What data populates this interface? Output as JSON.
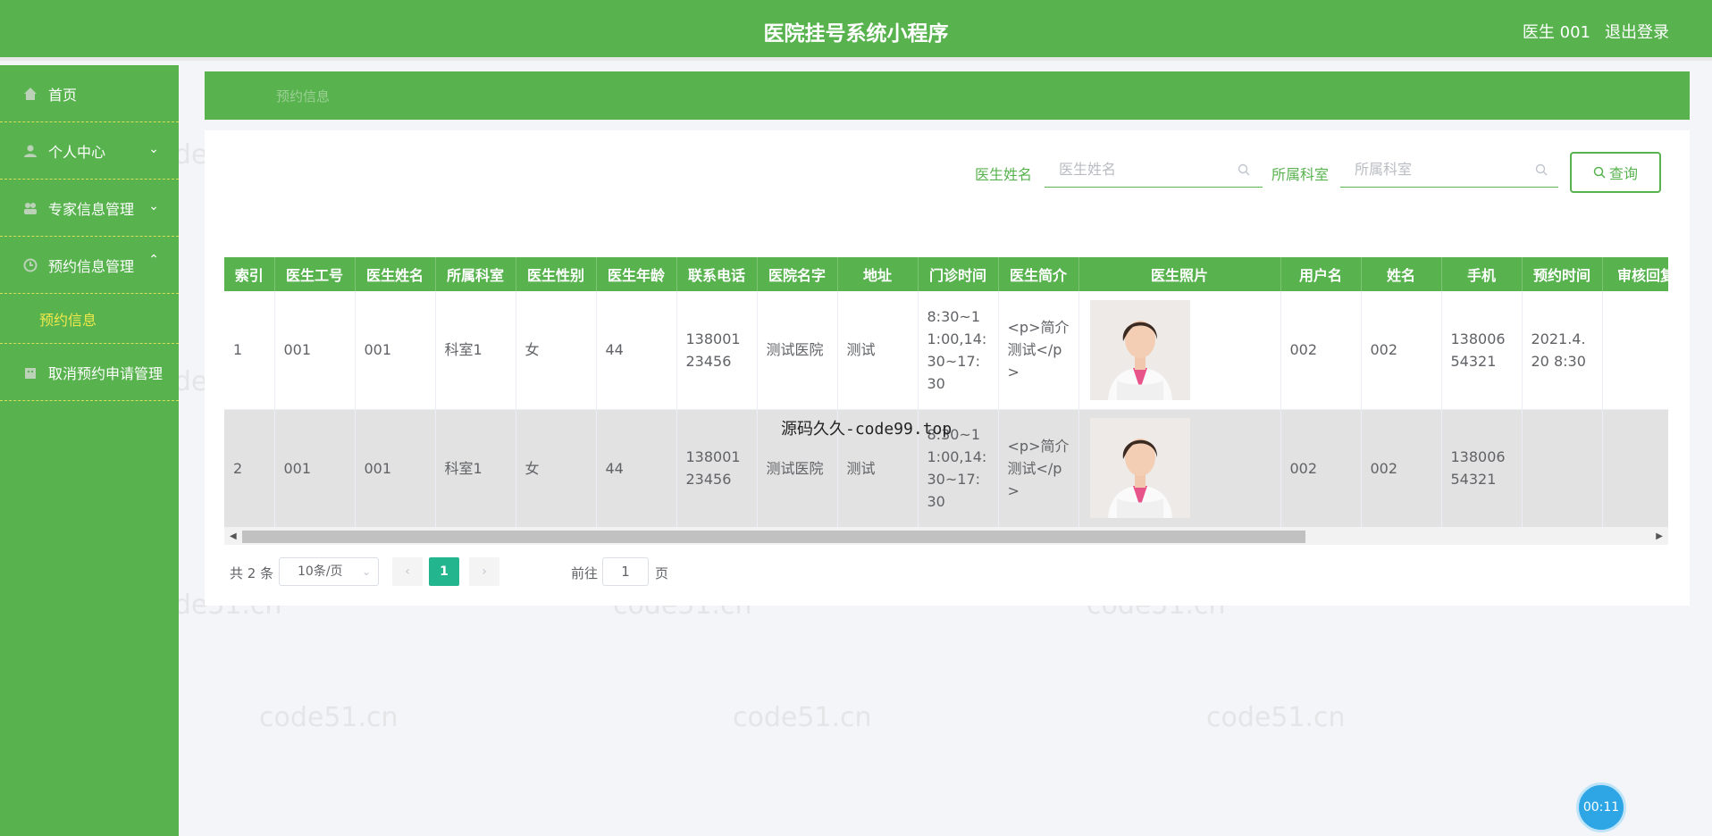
{
  "header": {
    "title": "医院挂号系统小程序",
    "user": "医生 001",
    "logout": "退出登录"
  },
  "sidebar": {
    "items": [
      {
        "label": "首页",
        "icon": "home-icon"
      },
      {
        "label": "个人中心",
        "icon": "user-icon"
      },
      {
        "label": "专家信息管理",
        "icon": "group-icon"
      },
      {
        "label": "预约信息管理",
        "icon": "clock-icon"
      },
      {
        "label": "取消预约申请管理",
        "icon": "building-icon"
      }
    ],
    "sub_active": "预约信息"
  },
  "breadcrumb": "预约信息",
  "search": {
    "doctor_label": "医生姓名",
    "doctor_placeholder": "医生姓名",
    "dept_label": "所属科室",
    "dept_placeholder": "所属科室",
    "query_button": "查询"
  },
  "table": {
    "headers": [
      "索引",
      "医生工号",
      "医生姓名",
      "所属科室",
      "医生性别",
      "医生年龄",
      "联系电话",
      "医院名字",
      "地址",
      "门诊时间",
      "医生简介",
      "医生照片",
      "用户名",
      "姓名",
      "手机",
      "预约时间",
      "审核回复"
    ],
    "rows": [
      {
        "index": "1",
        "doc_id": "001",
        "doc_name": "001",
        "dept": "科室1",
        "gender": "女",
        "age": "44",
        "phone": "13800123456",
        "hospital": "测试医院",
        "address": "测试",
        "hours": "8:30~11:00,14:30~17:30",
        "intro": "<p>简介测试</p>",
        "username": "002",
        "name": "002",
        "mobile": "13800654321",
        "appt_time": "2021.4.20 8:30",
        "reply": ""
      },
      {
        "index": "2",
        "doc_id": "001",
        "doc_name": "001",
        "dept": "科室1",
        "gender": "女",
        "age": "44",
        "phone": "13800123456",
        "hospital": "测试医院",
        "address": "测试",
        "hours": "8:30~11:00,14:30~17:30",
        "intro": "<p>简介测试</p>",
        "username": "002",
        "name": "002",
        "mobile": "13800654321",
        "appt_time": "",
        "reply": ""
      }
    ]
  },
  "pagination": {
    "total": "共 2 条",
    "page_size": "10条/页",
    "current": "1",
    "goto_prefix": "前往",
    "goto_value": "1",
    "goto_suffix": "页",
    "prev_symbol": "‹",
    "next_symbol": "›"
  },
  "overlay_text": "源码久久-code99.top",
  "watermark": "code51.cn",
  "timer": "00:11",
  "colors": {
    "primary": "#58b34f",
    "active_page": "#23b58d",
    "submenu_active": "#f0e84b"
  }
}
